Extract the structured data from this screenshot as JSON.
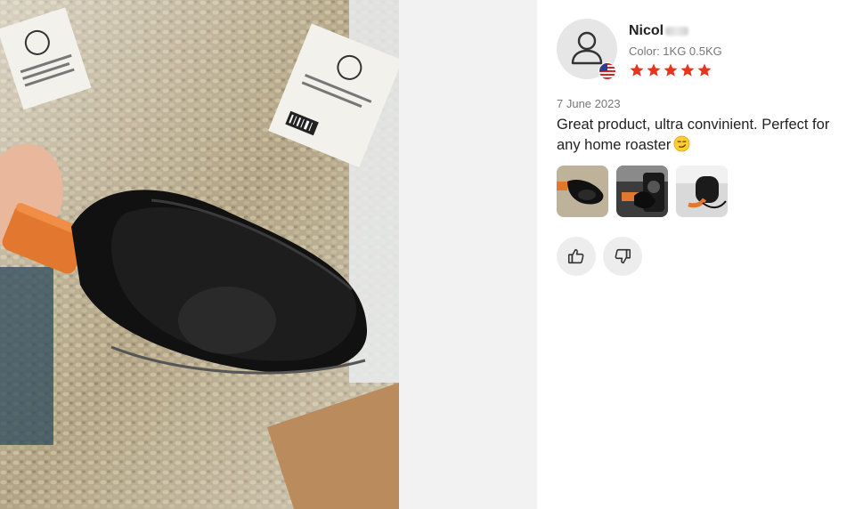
{
  "photo": {
    "alt": "coffee-scoop-photo"
  },
  "review": {
    "reviewer_name": "Nicol",
    "color_label": "Color: 1KG 0.5KG",
    "rating": 5,
    "rating_max": 5,
    "date": "7 June 2023",
    "text": "Great product, ultra convinient. Perfect for any home roaster",
    "flag": "us-flag",
    "star_color": "#e8331f",
    "thumbnails": [
      "review-photo-1",
      "review-photo-2",
      "review-photo-3"
    ],
    "helpful_icon": "thumbs-up-icon",
    "not_helpful_icon": "thumbs-down-icon"
  }
}
